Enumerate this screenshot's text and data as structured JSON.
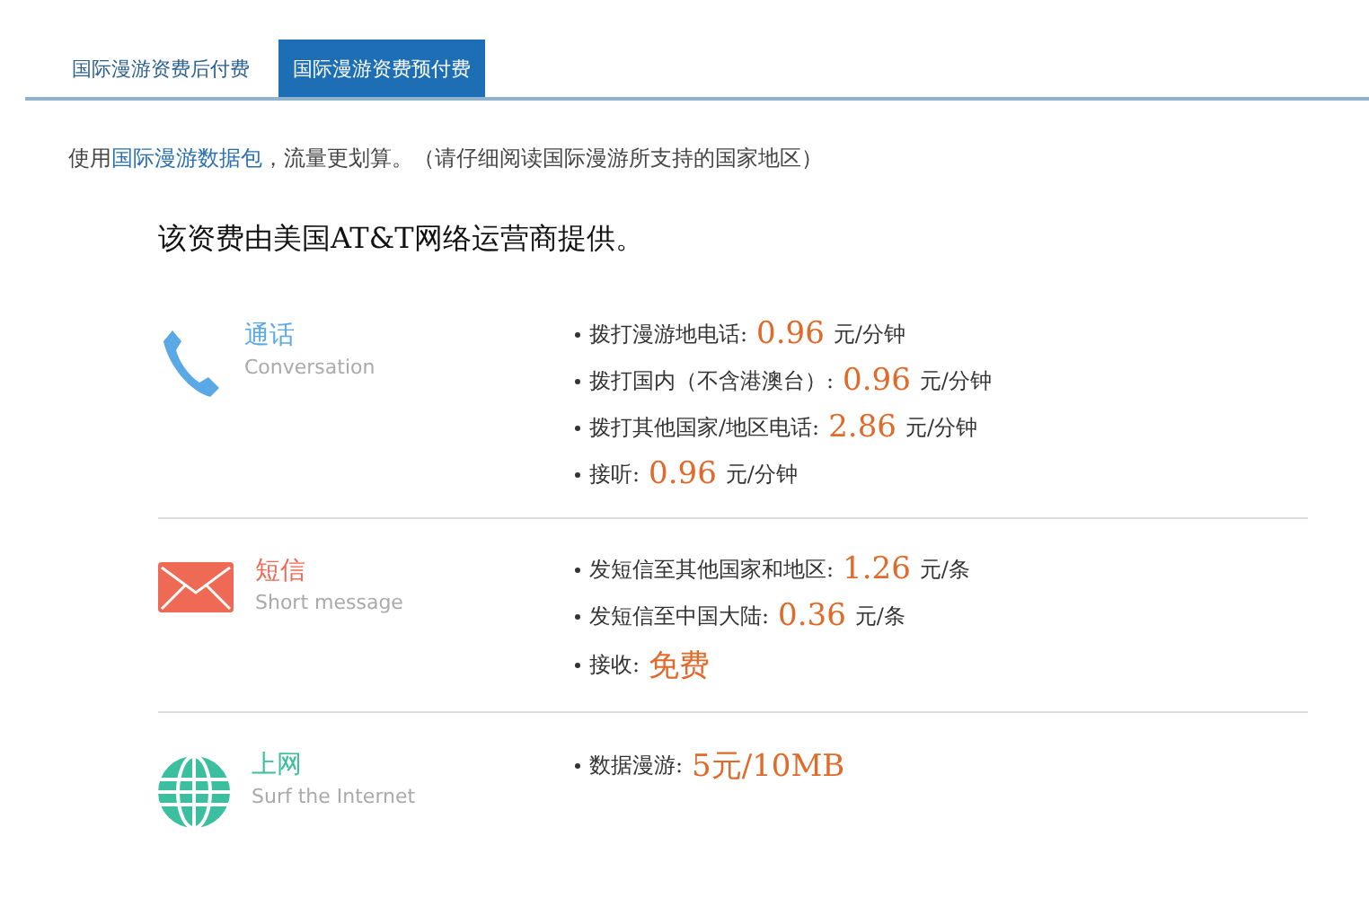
{
  "tabs": [
    {
      "label": "国际漫游资费后付费",
      "selected": false
    },
    {
      "label": "国际漫游资费预付费",
      "selected": true
    }
  ],
  "intro": {
    "before": "使用",
    "link": "国际漫游数据包",
    "after": "，流量更划算。（请仔细阅读国际漫游所支持的国家地区）"
  },
  "heading": "该资费由美国AT&T网络运营商提供。",
  "sections": [
    {
      "kind": "phone",
      "color": "#5aa9e6",
      "title": "通话",
      "subtitle": "Conversation",
      "items": [
        {
          "label": "拨打漫游地电话:",
          "value": "0.96",
          "unit": "元/分钟"
        },
        {
          "label": "拨打国内（不含港澳台）:",
          "value": "0.96",
          "unit": "元/分钟"
        },
        {
          "label": "拨打其他国家/地区电话:",
          "value": "2.86",
          "unit": "元/分钟"
        },
        {
          "label": "接听:",
          "value": "0.96",
          "unit": "元/分钟"
        }
      ]
    },
    {
      "kind": "mail",
      "color": "#ee6a55",
      "title": "短信",
      "subtitle": "Short message",
      "items": [
        {
          "label": "发短信至其他国家和地区:",
          "value": "1.26",
          "unit": "元/条"
        },
        {
          "label": "发短信至中国大陆:",
          "value": "0.36",
          "unit": "元/条"
        },
        {
          "label": "接收:",
          "value": "免费"
        }
      ]
    },
    {
      "kind": "globe",
      "color": "#3cbf9f",
      "title": "上网",
      "subtitle": "Surf the Internet",
      "items": [
        {
          "label": "数据漫游:",
          "value": "5元/10MB"
        }
      ]
    }
  ]
}
